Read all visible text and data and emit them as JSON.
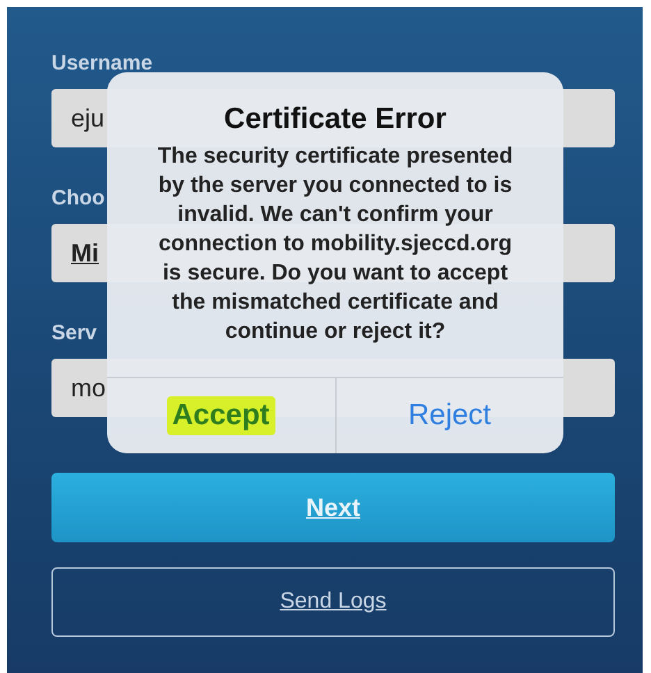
{
  "form": {
    "fields": [
      {
        "label": "Username",
        "value": "eju",
        "kind": "text"
      },
      {
        "label": "Choo",
        "value": "Mi",
        "kind": "link"
      },
      {
        "label": "Serv",
        "value": "mo",
        "kind": "text"
      }
    ],
    "next_button": "Next",
    "send_logs_button": "Send Logs"
  },
  "alert": {
    "title": "Certificate Error",
    "message": "The security certificate presented by the server you connected to is invalid. We can't confirm your connection to mobility.sjeccd.org is secure. Do you want to accept the mismatched certificate and continue or reject it?",
    "actions": [
      {
        "label": "Accept",
        "highlighted": true
      },
      {
        "label": "Reject",
        "highlighted": false
      }
    ]
  }
}
